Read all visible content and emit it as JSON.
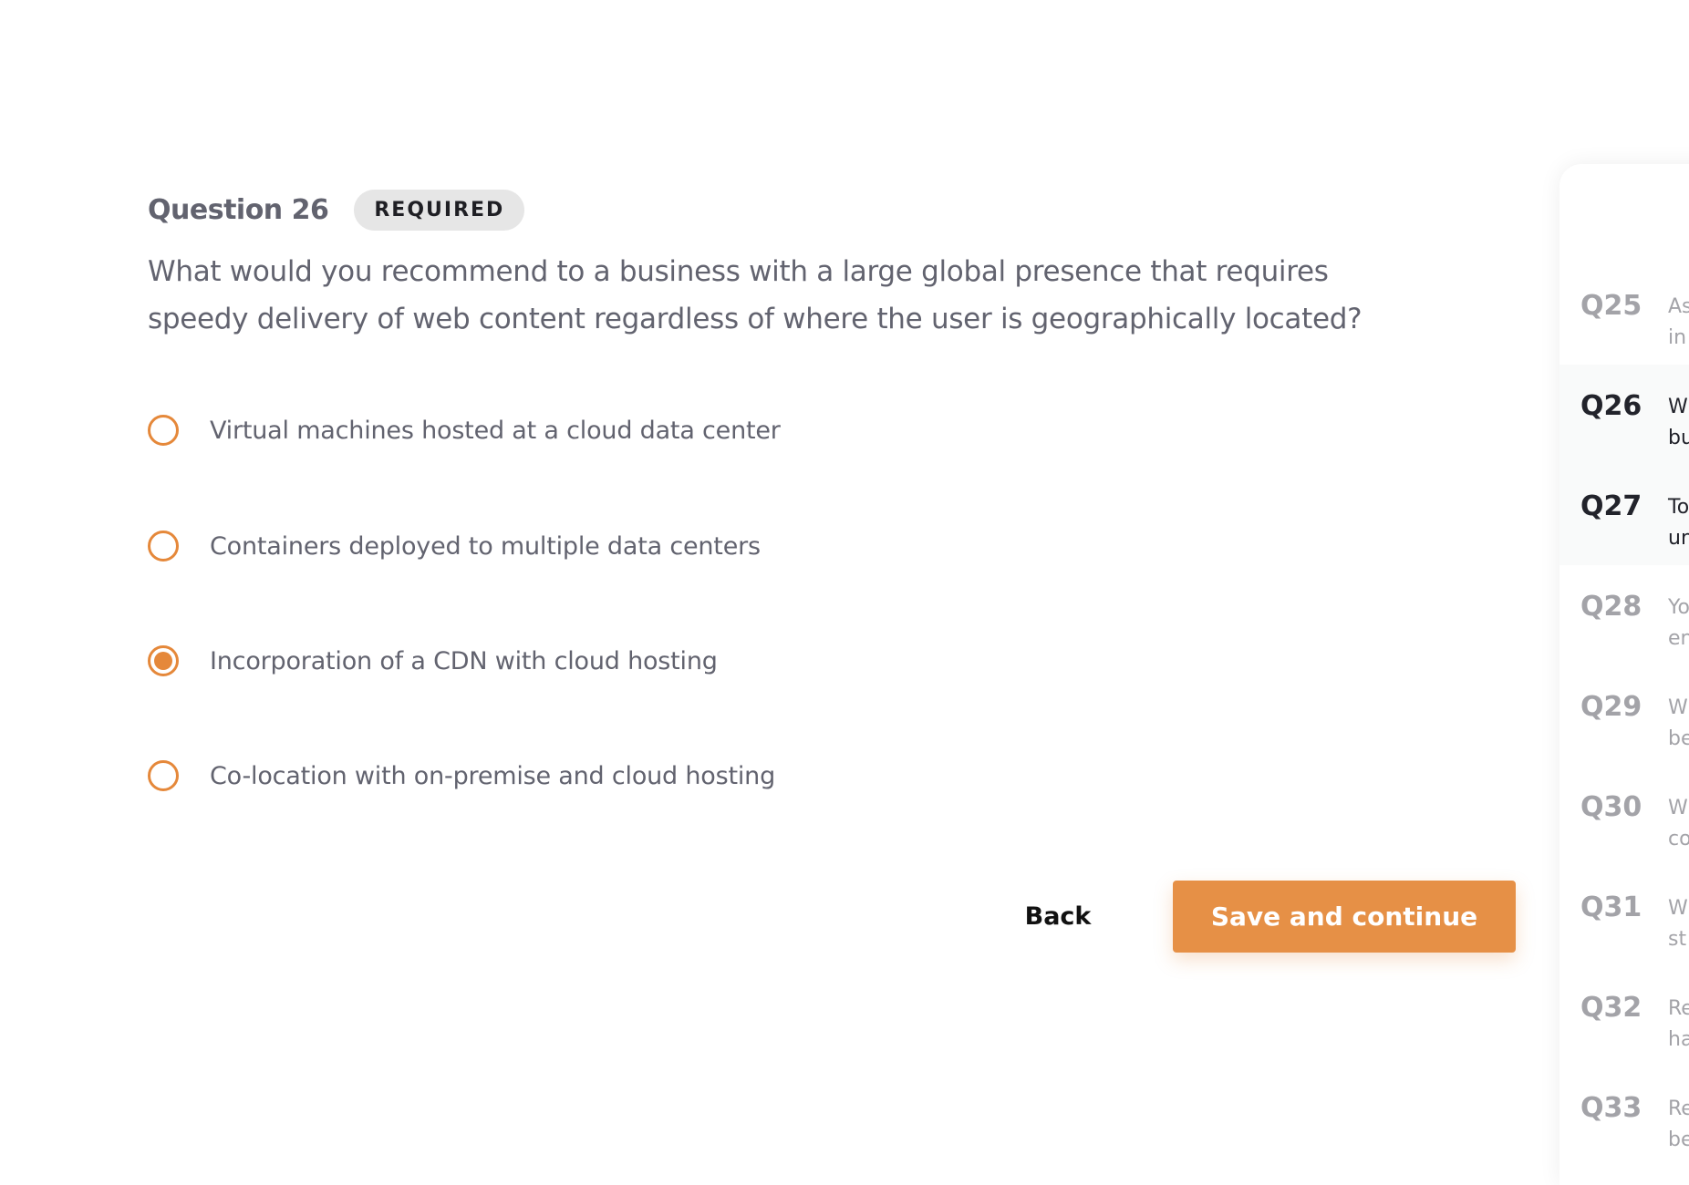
{
  "question": {
    "title": "Question 26",
    "badge": "REQUIRED",
    "text": "What would you recommend to a business with a large global presence that requires speedy delivery of web content regardless of where the user is geographically located?",
    "options": [
      {
        "label": "Virtual machines hosted at a cloud data center",
        "selected": false
      },
      {
        "label": "Containers deployed to multiple data centers",
        "selected": false
      },
      {
        "label": "Incorporation of a CDN with cloud hosting",
        "selected": true
      },
      {
        "label": "Co-location with on-premise and cloud hosting",
        "selected": false
      }
    ]
  },
  "actions": {
    "back": "Back",
    "save": "Save and continue"
  },
  "colors": {
    "accent": "#e5883a",
    "button": "#e69046"
  },
  "sidebar": {
    "items": [
      {
        "num": "Q25",
        "text": "As\nin",
        "state": "dim"
      },
      {
        "num": "Q26",
        "text": "W\nbu",
        "state": "active"
      },
      {
        "num": "Q27",
        "text": "To\nun",
        "state": "active"
      },
      {
        "num": "Q28",
        "text": "Yo\nen",
        "state": "dim"
      },
      {
        "num": "Q29",
        "text": "W\nbe",
        "state": "dim"
      },
      {
        "num": "Q30",
        "text": "W\nco",
        "state": "dim"
      },
      {
        "num": "Q31",
        "text": "W\nst",
        "state": "dim"
      },
      {
        "num": "Q32",
        "text": "Re\nha",
        "state": "dim"
      },
      {
        "num": "Q33",
        "text": "Re\nbe",
        "state": "dim"
      }
    ]
  }
}
